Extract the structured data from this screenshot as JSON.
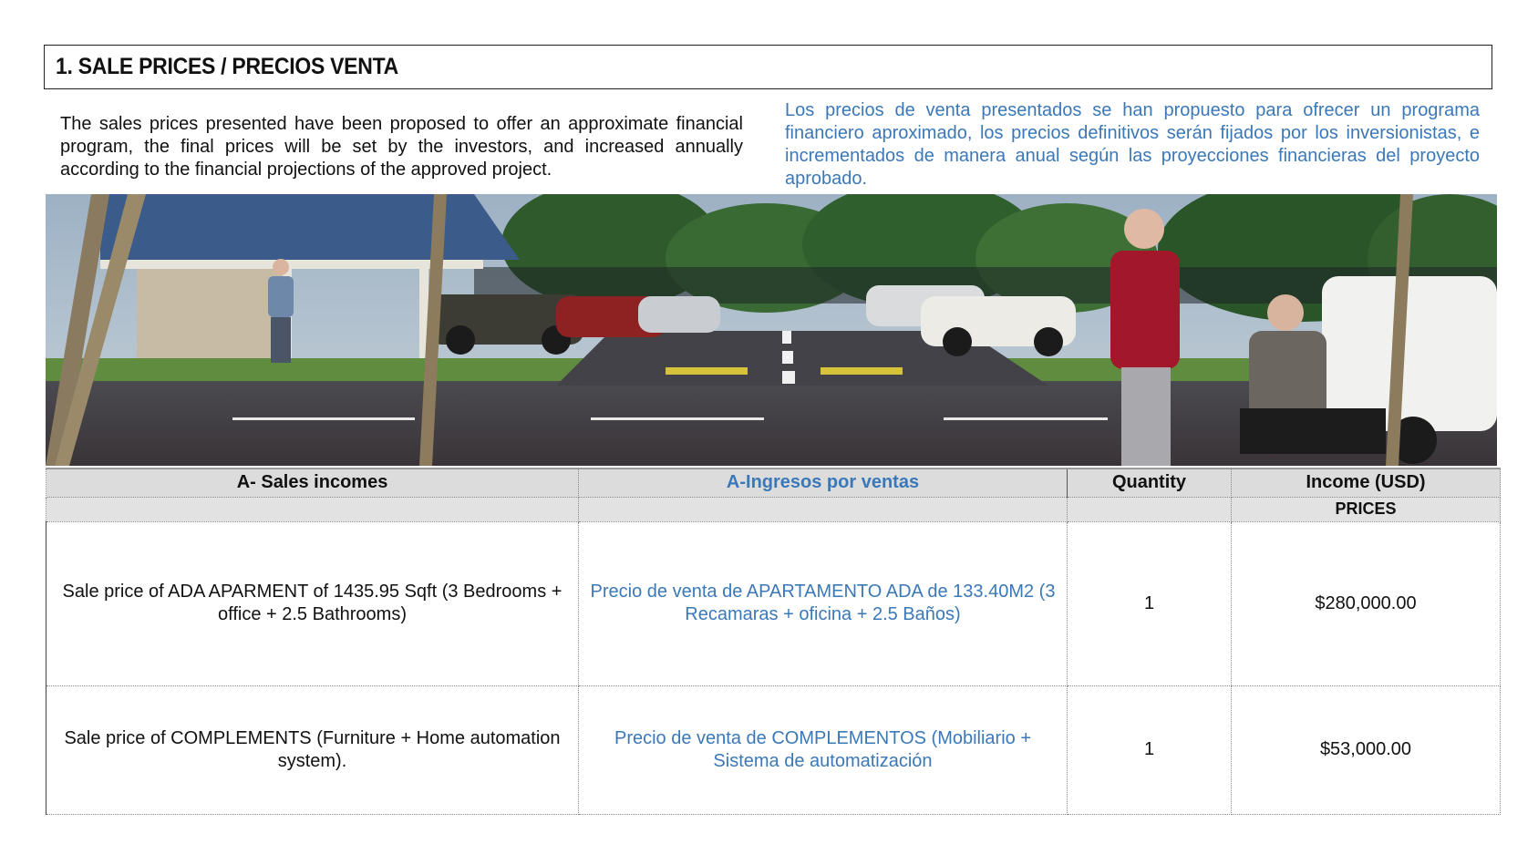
{
  "section": {
    "title": "1. SALE PRICES / PRECIOS VENTA"
  },
  "intro": {
    "english": "The sales prices presented have been proposed to offer an approximate financial program, the final prices will be set by the investors, and increased annually according to the financial projections of the approved project.",
    "spanish": "Los precios de venta presentados se han propuesto para ofrecer un programa financiero aproximado, los precios definitivos serán fijados por los inversionistas, e incrementados de manera anual según las proyecciones financieras del proyecto aprobado."
  },
  "image": {
    "subject": "parking-lot-render"
  },
  "table": {
    "headers": {
      "sales_incomes": "A- Sales incomes",
      "ingresos": "A-Ingresos por ventas",
      "quantity": "Quantity",
      "income": "Income (USD)",
      "prices": "PRICES"
    },
    "rows": [
      {
        "description_en": "Sale price of ADA APARMENT of 1435.95 Sqft (3 Bedrooms + office + 2.5 Bathrooms)",
        "description_es": "Precio de venta de APARTAMENTO ADA de 133.40M2 (3 Recamaras + oficina + 2.5 Baños)",
        "quantity": "1",
        "price": "$280,000.00"
      },
      {
        "description_en": "Sale price of COMPLEMENTS (Furniture + Home automation system).",
        "description_es": "Precio de venta de COMPLEMENTOS (Mobiliario + Sistema de automatización",
        "quantity": "1",
        "price": "$53,000.00"
      }
    ]
  },
  "colors": {
    "spanish_text": "#3b78b8",
    "header_bg": "#dcdcdc"
  }
}
